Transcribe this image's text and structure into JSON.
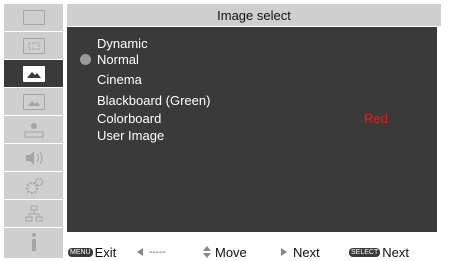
{
  "header": {
    "title": "Image select"
  },
  "sidebar": {
    "items": [
      {
        "icon": "monitor-icon"
      },
      {
        "icon": "pc-adjust-icon"
      },
      {
        "icon": "image-icon",
        "active": true
      },
      {
        "icon": "image-adjust-icon"
      },
      {
        "icon": "setting-icon"
      },
      {
        "icon": "sound-icon"
      },
      {
        "icon": "gear-icon"
      },
      {
        "icon": "network-icon"
      },
      {
        "icon": "info-icon"
      }
    ]
  },
  "menu": {
    "items": [
      {
        "label": "Dynamic"
      },
      {
        "label": "Normal",
        "selected": true
      },
      {
        "label": "Cinema"
      },
      {
        "label": "Blackboard (Green)"
      },
      {
        "label": "Colorboard",
        "value": "Red"
      },
      {
        "label": "User Image"
      }
    ]
  },
  "footer": {
    "exit_tag": "MENU",
    "exit": "Exit",
    "back": "-----",
    "move": "Move",
    "next": "Next",
    "select_tag": "SELECT",
    "select_next": "Next"
  },
  "colors": {
    "panel": "#3a3a3a",
    "sidebar": "#cfcfcf",
    "value": "#e02020"
  }
}
